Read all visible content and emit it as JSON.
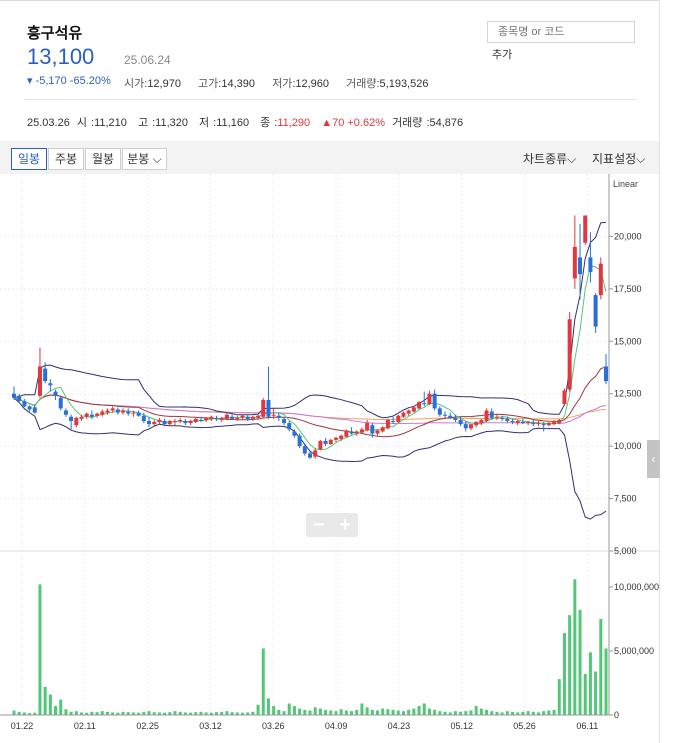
{
  "stock": {
    "name": "흥구석유",
    "price": "13,100",
    "date": "25.06.24",
    "change": "▾ -5,170 -65.20%",
    "open_label": "시가",
    "open": "12,970",
    "high_label": "고가",
    "high": "14,390",
    "low_label": "저가",
    "low": "12,960",
    "volume_label": "거래량",
    "volume": "5,193,526"
  },
  "search": {
    "placeholder": "종목명 or 코드",
    "add_label": "추가"
  },
  "daily": {
    "date": "25.03.26",
    "open_label": "시",
    "open": "11,210",
    "high_label": "고",
    "high": "11,320",
    "low_label": "저",
    "low": "11,160",
    "close_label": "종",
    "close": "11,290",
    "change": "▲70 +0.62%",
    "volume_label": "거래량",
    "volume": "54,876"
  },
  "toolbar": {
    "tabs": [
      "일봉",
      "주봉",
      "월봉",
      "분봉"
    ],
    "chart_type": "차트종류",
    "indicator_settings": "지표설정"
  },
  "chart_data": {
    "type": "candlestick",
    "scale_label": "Linear",
    "colors": {
      "up": "#e0383e",
      "down": "#2b6fd6",
      "volume": "#52c777",
      "bb": "#303070",
      "ma5": "#52c777",
      "ma20": "#9a3a3a",
      "ma60": "#c77ad6",
      "ma120": "#f0a35a"
    },
    "price_ticks": [
      "20,000",
      "17,500",
      "15,000",
      "12,500",
      "10,000",
      "7,500",
      "5,000"
    ],
    "price_range": [
      5000,
      22500
    ],
    "volume_ticks": [
      "10,000,000",
      "5,000,000",
      "0"
    ],
    "volume_range": [
      0,
      12500000
    ],
    "x_ticks": [
      "01.22",
      "02.11",
      "02.25",
      "03.12",
      "03.26",
      "04.09",
      "04.23",
      "05.12",
      "05.26",
      "06.11"
    ],
    "candles": [
      [
        12500,
        12850,
        12300,
        12200
      ],
      [
        12400,
        12500,
        12150,
        12050
      ],
      [
        12150,
        12250,
        11900,
        11850
      ],
      [
        11900,
        11950,
        11750,
        11650
      ],
      [
        11850,
        12000,
        11600,
        11550
      ],
      [
        12400,
        14700,
        13800,
        12300
      ],
      [
        13700,
        14000,
        13100,
        13000
      ],
      [
        13000,
        13200,
        12900,
        12600
      ],
      [
        12600,
        12700,
        12400,
        12200
      ],
      [
        12300,
        12400,
        11800,
        11700
      ],
      [
        11700,
        11800,
        11500,
        11400
      ],
      [
        11400,
        11500,
        11200,
        10800
      ],
      [
        11000,
        11400,
        11350,
        10900
      ],
      [
        11300,
        11500,
        11400,
        11200
      ],
      [
        11400,
        11600,
        11550,
        11300
      ],
      [
        11500,
        11700,
        11400,
        11300
      ],
      [
        11450,
        11600,
        11550,
        11350
      ],
      [
        11500,
        11750,
        11650,
        11400
      ],
      [
        11600,
        11800,
        11700,
        11500
      ],
      [
        11700,
        11900,
        11800,
        11600
      ],
      [
        11750,
        11850,
        11600,
        11500
      ],
      [
        11600,
        11800,
        11700,
        11500
      ],
      [
        11650,
        11800,
        11550,
        11450
      ],
      [
        11550,
        11700,
        11600,
        11400
      ],
      [
        11600,
        11700,
        11450,
        11400
      ],
      [
        11450,
        11600,
        11200,
        11100
      ],
      [
        11200,
        11400,
        11050,
        10900
      ],
      [
        11050,
        11250,
        11150,
        10950
      ],
      [
        11150,
        11350,
        11250,
        11050
      ],
      [
        11200,
        11300,
        11050,
        10950
      ],
      [
        11050,
        11250,
        11200,
        10950
      ],
      [
        11150,
        11300,
        11200,
        11000
      ],
      [
        11200,
        11350,
        11250,
        11100
      ],
      [
        11200,
        11300,
        11100,
        11000
      ],
      [
        11100,
        11250,
        11200,
        11000
      ],
      [
        11150,
        11350,
        11300,
        11100
      ],
      [
        11250,
        11400,
        11200,
        11150
      ],
      [
        11250,
        11400,
        11350,
        11150
      ],
      [
        11300,
        11450,
        11400,
        11200
      ],
      [
        11350,
        11450,
        11300,
        11200
      ],
      [
        11250,
        11400,
        11350,
        11150
      ],
      [
        11300,
        11600,
        11500,
        11250
      ],
      [
        11400,
        11550,
        11300,
        11250
      ],
      [
        11300,
        11450,
        11350,
        11200
      ],
      [
        11350,
        11500,
        11450,
        11250
      ],
      [
        11400,
        11500,
        11300,
        11200
      ],
      [
        11300,
        11450,
        11400,
        11200
      ],
      [
        11350,
        11500,
        11450,
        11250
      ],
      [
        11400,
        12300,
        12200,
        11350
      ],
      [
        12200,
        13800,
        11400,
        11300
      ],
      [
        11450,
        11800,
        11500,
        11300
      ],
      [
        11450,
        11600,
        11350,
        11200
      ],
      [
        11300,
        11400,
        11100,
        11000
      ],
      [
        11100,
        11200,
        10800,
        10700
      ],
      [
        10700,
        10800,
        10500,
        10400
      ],
      [
        10500,
        10600,
        10000,
        9900
      ],
      [
        10000,
        10050,
        9650,
        9550
      ],
      [
        9650,
        9800,
        9450,
        9400
      ],
      [
        9500,
        9900,
        9800,
        9400
      ],
      [
        9850,
        10300,
        10250,
        9800
      ],
      [
        10250,
        10400,
        10100,
        10000
      ],
      [
        10100,
        10350,
        10300,
        10050
      ],
      [
        10300,
        10450,
        10400,
        10200
      ],
      [
        10350,
        10550,
        10500,
        10250
      ],
      [
        10450,
        10800,
        10750,
        10400
      ],
      [
        10700,
        10900,
        10600,
        10550
      ],
      [
        10600,
        10750,
        10700,
        10500
      ],
      [
        10650,
        10900,
        10800,
        10600
      ],
      [
        10750,
        11250,
        11100,
        10700
      ],
      [
        11000,
        11100,
        10600,
        10400
      ],
      [
        10600,
        10800,
        10750,
        10500
      ],
      [
        10700,
        10950,
        10900,
        10650
      ],
      [
        10850,
        11300,
        11250,
        10800
      ],
      [
        11200,
        11400,
        11150,
        11050
      ],
      [
        11150,
        11500,
        11450,
        11100
      ],
      [
        11400,
        11650,
        11600,
        11350
      ],
      [
        11550,
        11750,
        11700,
        11450
      ],
      [
        11650,
        11900,
        11850,
        11600
      ],
      [
        11800,
        12150,
        12100,
        11750
      ],
      [
        12050,
        12600,
        12000,
        11900
      ],
      [
        12000,
        12650,
        12500,
        11950
      ],
      [
        12500,
        12700,
        11800,
        11700
      ],
      [
        11800,
        11900,
        11500,
        11400
      ],
      [
        11500,
        11650,
        11450,
        11350
      ],
      [
        11450,
        11600,
        11350,
        11300
      ],
      [
        11350,
        11500,
        11250,
        11150
      ],
      [
        11250,
        11400,
        11050,
        10950
      ],
      [
        11050,
        11200,
        10850,
        10700
      ],
      [
        10850,
        11000,
        11050,
        10750
      ],
      [
        11000,
        11200,
        11150,
        10900
      ],
      [
        11100,
        11300,
        11250,
        11000
      ],
      [
        11200,
        11800,
        11700,
        11150
      ],
      [
        11650,
        11800,
        11350,
        11250
      ],
      [
        11350,
        11500,
        11400,
        11250
      ],
      [
        11350,
        11450,
        11300,
        11200
      ],
      [
        11300,
        11400,
        11200,
        11100
      ],
      [
        11200,
        11300,
        11150,
        11050
      ],
      [
        11100,
        11250,
        11200,
        11000
      ],
      [
        11150,
        11300,
        11100,
        11050
      ],
      [
        11100,
        11200,
        11150,
        11000
      ],
      [
        11100,
        11250,
        11050,
        10950
      ],
      [
        11050,
        11200,
        11100,
        10950
      ],
      [
        11050,
        11150,
        11000,
        10700
      ],
      [
        11000,
        11150,
        11100,
        10950
      ],
      [
        11050,
        11250,
        11150,
        11000
      ],
      [
        11100,
        11300,
        11250,
        11050
      ],
      [
        12000,
        12750,
        12650,
        11950
      ],
      [
        12700,
        16400,
        16050,
        12600
      ],
      [
        18000,
        21000,
        19500,
        17500
      ],
      [
        19000,
        20600,
        18200,
        17000
      ],
      [
        19700,
        20700,
        21000,
        19600
      ],
      [
        19000,
        20200,
        18300,
        17800
      ],
      [
        17200,
        17300,
        15700,
        15400
      ],
      [
        17200,
        19000,
        18700,
        17000
      ],
      [
        13800,
        14390,
        13100,
        12960
      ]
    ],
    "volumes": [
      350000,
      250000,
      200000,
      150000,
      180000,
      10200000,
      2200000,
      1600000,
      700000,
      1200000,
      450000,
      250000,
      300000,
      200000,
      180000,
      250000,
      220000,
      300000,
      250000,
      200000,
      180000,
      250000,
      220000,
      200000,
      180000,
      250000,
      300000,
      220000,
      200000,
      180000,
      220000,
      300000,
      250000,
      200000,
      180000,
      220000,
      250000,
      200000,
      180000,
      220000,
      250000,
      300000,
      220000,
      200000,
      180000,
      200000,
      250000,
      800000,
      5200000,
      1300000,
      700000,
      400000,
      300000,
      900000,
      700000,
      500000,
      400000,
      350000,
      600000,
      500000,
      400000,
      350000,
      300000,
      450000,
      350000,
      300000,
      400000,
      900000,
      600000,
      400000,
      350000,
      500000,
      450000,
      400000,
      350000,
      300000,
      400000,
      500000,
      700000,
      900000,
      500000,
      400000,
      300000,
      250000,
      200000,
      300000,
      250000,
      300000,
      350000,
      700000,
      500000,
      400000,
      300000,
      250000,
      200000,
      300000,
      250000,
      200000,
      250000,
      300000,
      250000,
      200000,
      300000,
      350000,
      400000,
      2800000,
      6400000,
      7800000,
      10600000,
      8200000,
      3200000,
      4900000,
      3400000,
      7500000,
      5200000
    ]
  }
}
